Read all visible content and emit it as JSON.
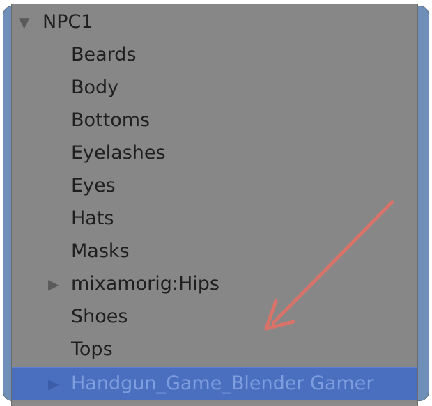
{
  "tree": {
    "root": {
      "label": "NPC1",
      "expanded": true
    },
    "children": [
      {
        "label": "Beards",
        "has_children": false
      },
      {
        "label": "Body",
        "has_children": false
      },
      {
        "label": "Bottoms",
        "has_children": false
      },
      {
        "label": "Eyelashes",
        "has_children": false
      },
      {
        "label": "Eyes",
        "has_children": false
      },
      {
        "label": "Hats",
        "has_children": false
      },
      {
        "label": "Masks",
        "has_children": false
      },
      {
        "label": "mixamorig:Hips",
        "has_children": true
      },
      {
        "label": "Shoes",
        "has_children": false
      },
      {
        "label": "Tops",
        "has_children": false
      }
    ],
    "selected_item": {
      "label": "Handgun_Game_Blender Gamer",
      "has_children": true
    }
  },
  "colors": {
    "panel_background": "#878787",
    "selection_background": "#4a6fbe",
    "annotation_arrow": "#d9736a"
  },
  "icons": {
    "expanded": "disclosure-triangle-down-icon",
    "collapsed": "disclosure-triangle-right-icon"
  },
  "annotation": {
    "type": "arrow",
    "color": "#d9736a"
  }
}
